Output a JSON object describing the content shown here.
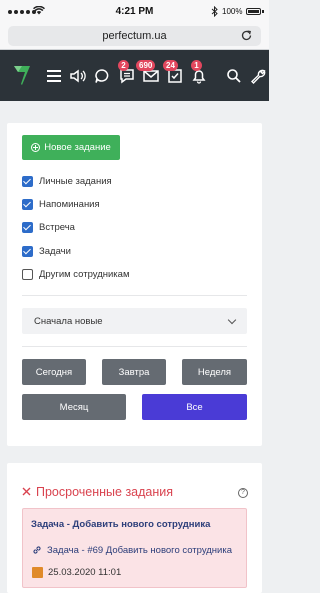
{
  "status_bar": {
    "time": "4:21 PM",
    "battery": "100%"
  },
  "browser": {
    "url": "perfectum.ua"
  },
  "header": {
    "badges": {
      "tasks": "2",
      "mail": "690",
      "checks": "24",
      "bell": "1"
    }
  },
  "filters": {
    "new_task_label": "Новое задание",
    "checkboxes": [
      {
        "label": "Личные задания",
        "checked": true
      },
      {
        "label": "Напоминания",
        "checked": true
      },
      {
        "label": "Встреча",
        "checked": true
      },
      {
        "label": "Задачи",
        "checked": true
      },
      {
        "label": "Другим сотрудникам",
        "checked": false
      }
    ],
    "sort_selected": "Сначала новые",
    "periods": [
      "Сегодня",
      "Завтра",
      "Неделя",
      "Месяц",
      "Все"
    ],
    "active_period": "Все"
  },
  "overdue": {
    "title": "Просроченные задания",
    "help": "?",
    "task": {
      "title": "Задача - Добавить нового сотрудника",
      "link": "Задача - #69 Добавить нового сотрудника",
      "date": "25.03.2020 11:01"
    }
  },
  "colors": {
    "accent_green": "#3fb05a",
    "active_blue": "#4a3bd6",
    "overdue_red": "#d9434f",
    "header_bg": "#2c3339"
  }
}
